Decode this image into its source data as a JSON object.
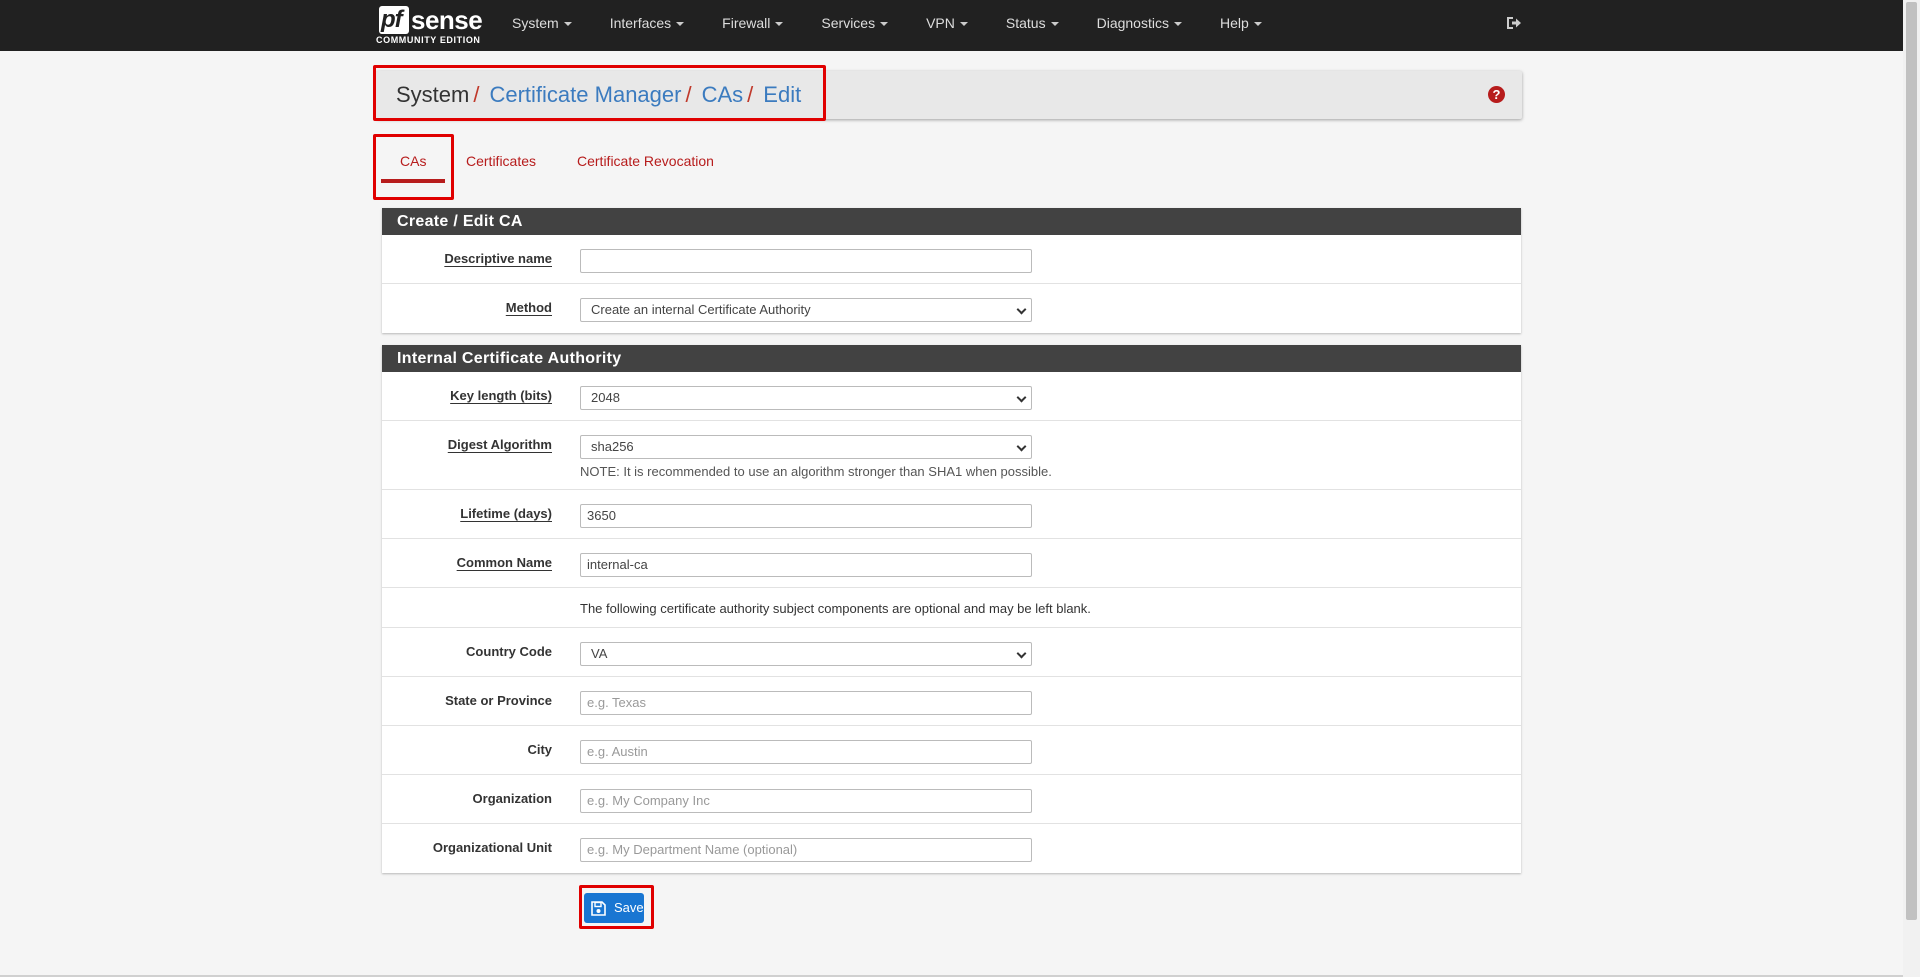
{
  "brand": {
    "name_pf": "pf",
    "name_sense": "sense",
    "edition": "COMMUNITY EDITION"
  },
  "nav": {
    "items": [
      {
        "label": "System"
      },
      {
        "label": "Interfaces"
      },
      {
        "label": "Firewall"
      },
      {
        "label": "Services"
      },
      {
        "label": "VPN"
      },
      {
        "label": "Status"
      },
      {
        "label": "Diagnostics"
      },
      {
        "label": "Help"
      }
    ]
  },
  "breadcrumb": {
    "items": [
      "System",
      "Certificate Manager",
      "CAs",
      "Edit"
    ],
    "separator": "/"
  },
  "help": {
    "glyph": "?"
  },
  "tabs": [
    {
      "label": "CAs",
      "active": true
    },
    {
      "label": "Certificates"
    },
    {
      "label": "Certificate Revocation"
    }
  ],
  "create_edit": {
    "title": "Create / Edit CA",
    "descriptive_name": {
      "label": "Descriptive name",
      "value": ""
    },
    "method": {
      "label": "Method",
      "value": "Create an internal Certificate Authority"
    }
  },
  "internal_ca": {
    "title": "Internal Certificate Authority",
    "key_length": {
      "label": "Key length (bits)",
      "value": "2048"
    },
    "digest": {
      "label": "Digest Algorithm",
      "value": "sha256",
      "note": "NOTE: It is recommended to use an algorithm stronger than SHA1 when possible."
    },
    "lifetime": {
      "label": "Lifetime (days)",
      "value": "3650"
    },
    "common_name": {
      "label": "Common Name",
      "value": "internal-ca"
    },
    "optional_note": "The following certificate authority subject components are optional and may be left blank.",
    "country": {
      "label": "Country Code",
      "value": "VA"
    },
    "state": {
      "label": "State or Province",
      "placeholder": "e.g. Texas"
    },
    "city": {
      "label": "City",
      "placeholder": "e.g. Austin"
    },
    "organization": {
      "label": "Organization",
      "placeholder": "e.g. My Company Inc"
    },
    "org_unit": {
      "label": "Organizational Unit",
      "placeholder": "e.g. My Department Name (optional)"
    }
  },
  "save": {
    "label": "Save"
  },
  "colors": {
    "navbar": "#212121",
    "accent_red": "#b71c1c",
    "link_blue": "#3b7bbf",
    "button_blue": "#1976d2",
    "annotation_red": "#e00000"
  }
}
